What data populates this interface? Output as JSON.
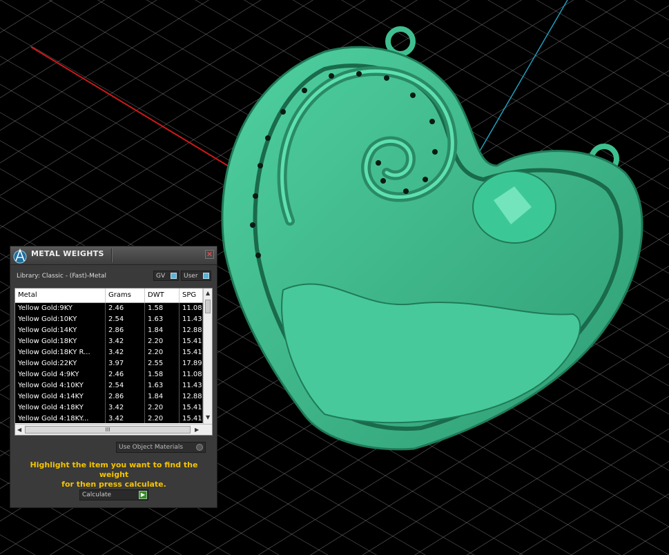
{
  "panel": {
    "title": "METAL WEIGHTS",
    "close_glyph": "✕",
    "library_label": "Library: Classic - (Fast)-Metal",
    "gv_label": "GV",
    "user_label": "User",
    "columns": [
      "Metal",
      "Grams",
      "DWT",
      "SPG"
    ],
    "rows": [
      [
        "Yellow Gold:9KY",
        "2.46",
        "1.58",
        "11.08"
      ],
      [
        "Yellow Gold:10KY",
        "2.54",
        "1.63",
        "11.43"
      ],
      [
        "Yellow Gold:14KY",
        "2.86",
        "1.84",
        "12.88"
      ],
      [
        "Yellow Gold:18KY",
        "3.42",
        "2.20",
        "15.41"
      ],
      [
        "Yellow Gold:18KY R...",
        "3.42",
        "2.20",
        "15.41"
      ],
      [
        "Yellow Gold:22KY",
        "3.97",
        "2.55",
        "17.89"
      ],
      [
        "Yellow Gold 4:9KY",
        "2.46",
        "1.58",
        "11.08"
      ],
      [
        "Yellow Gold 4:10KY",
        "2.54",
        "1.63",
        "11.43"
      ],
      [
        "Yellow Gold 4:14KY",
        "2.86",
        "1.84",
        "12.88"
      ],
      [
        "Yellow Gold 4:18KY",
        "3.42",
        "2.20",
        "15.41"
      ],
      [
        "Yellow Gold 4:18KY...",
        "3.42",
        "2.20",
        "15.41"
      ]
    ],
    "scroll_grip": "III",
    "use_object_materials": "Use Object Materials",
    "hint_line1": "Highlight the item you want to find the weight",
    "hint_line2": "for then press calculate.",
    "calculate_label": "Calculate",
    "accent_color": "#f5c400",
    "model_color": "#3fbf90"
  }
}
